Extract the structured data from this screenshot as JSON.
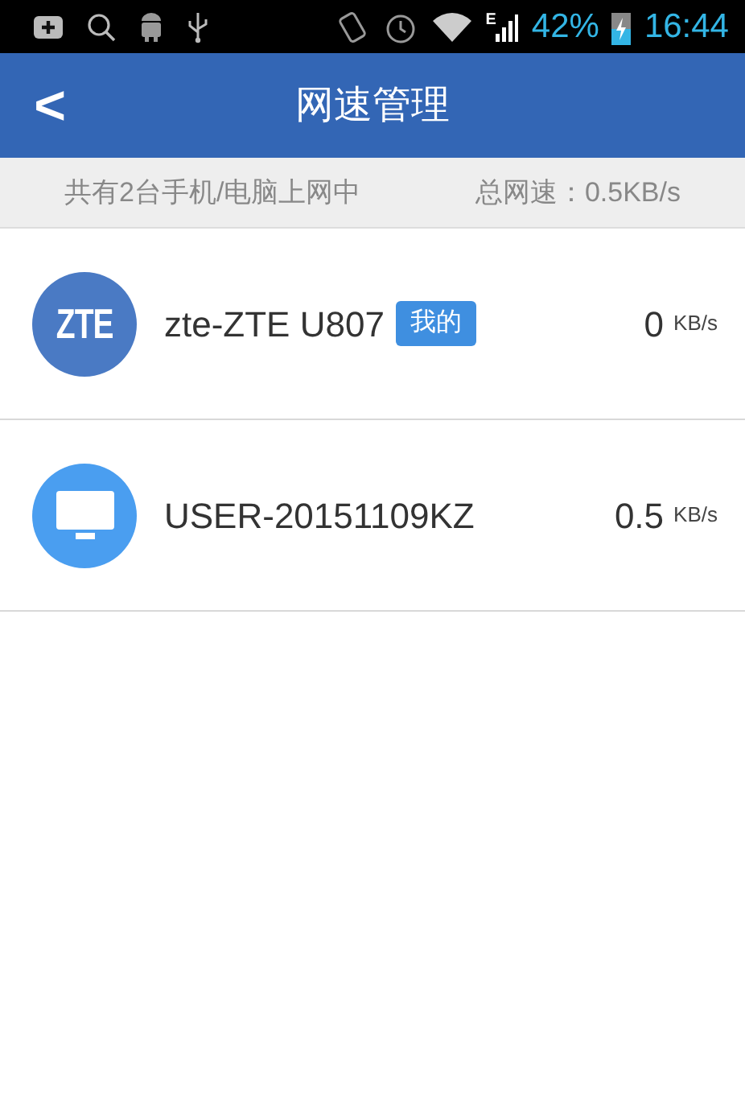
{
  "status_bar": {
    "network": "E",
    "battery": "42%",
    "time": "16:44"
  },
  "header": {
    "title": "网速管理",
    "back": "<"
  },
  "summary": {
    "devices": "共有2台手机/电脑上网中",
    "total_speed": "总网速：0.5KB/s"
  },
  "devices": [
    {
      "kind": "phone",
      "logo": "ZTE",
      "name": "zte-ZTE U807",
      "badge": "我的",
      "speed": "0",
      "unit": "KB/s"
    },
    {
      "kind": "pc",
      "name": "USER-20151109KZ",
      "speed": "0.5",
      "unit": "KB/s"
    }
  ]
}
